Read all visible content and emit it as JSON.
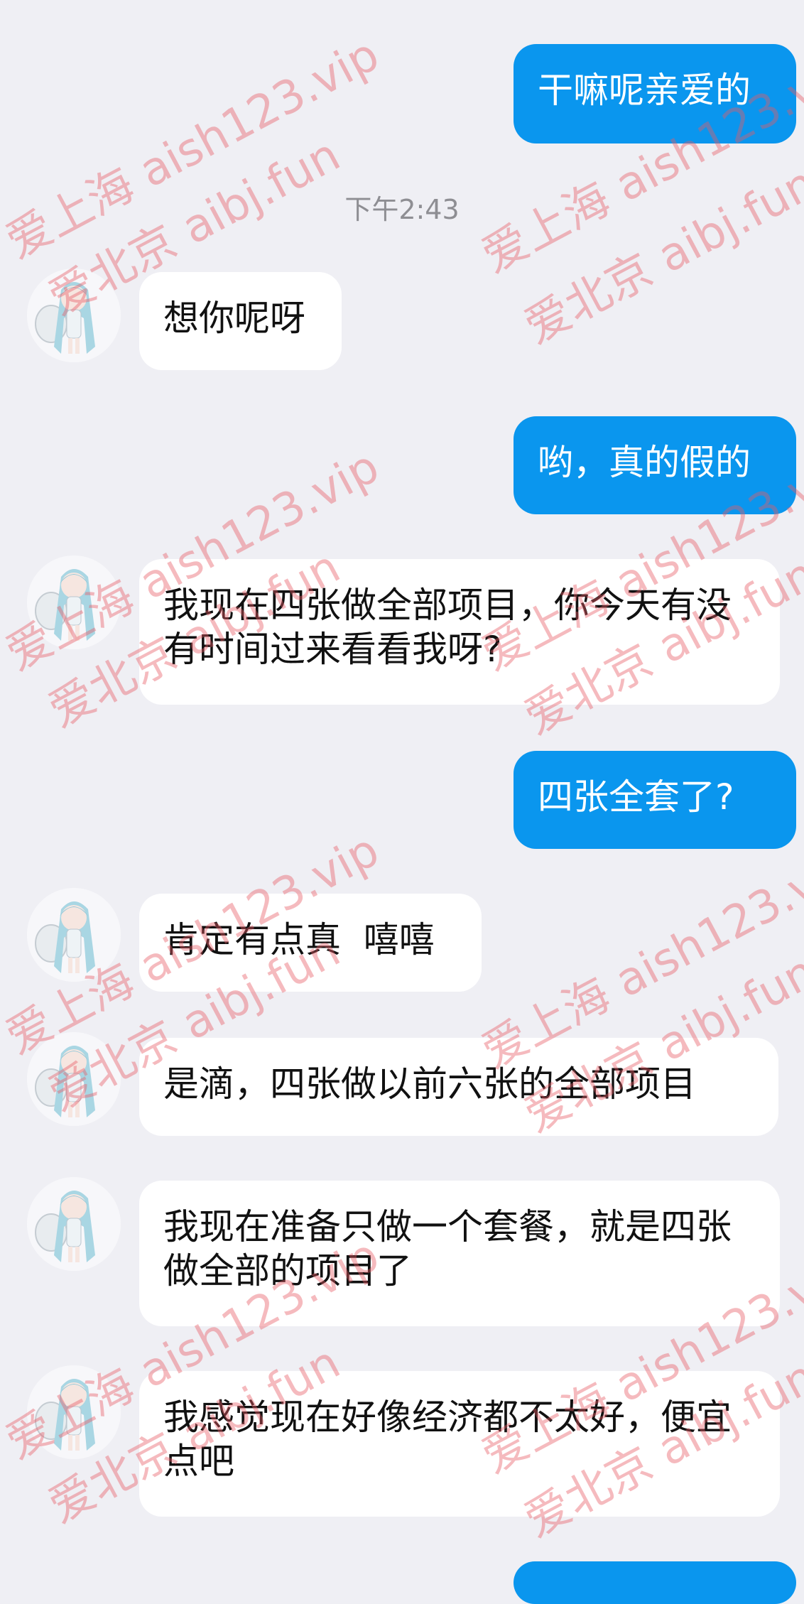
{
  "chat": {
    "messages": [
      {
        "id": "m1",
        "direction": "out",
        "text": "干嘛呢亲爱的"
      },
      {
        "id": "ts",
        "type": "timestamp",
        "text": "下午2:43"
      },
      {
        "id": "m2",
        "direction": "in",
        "text": "想你呢呀"
      },
      {
        "id": "m3",
        "direction": "out",
        "text": "哟，真的假的"
      },
      {
        "id": "m4",
        "direction": "in",
        "text": "我现在四张做全部项目，你今天有没有时间过来看看我呀?"
      },
      {
        "id": "m5",
        "direction": "out",
        "text": "四张全套了?"
      },
      {
        "id": "m6",
        "direction": "in",
        "text": "肯定有点真  嘻嘻"
      },
      {
        "id": "m7",
        "direction": "in",
        "text": "是滴，四张做以前六张的全部项目"
      },
      {
        "id": "m8",
        "direction": "in",
        "text": "我现在准备只做一个套餐，就是四张做全部的项目了"
      },
      {
        "id": "m9",
        "direction": "in",
        "text": "我感觉现在好像经济都不太好，便宜点吧"
      }
    ]
  },
  "watermark": {
    "line_a": "爱上海 aish123.vip",
    "line_b": "爱北京 aibj.fun"
  },
  "colors": {
    "background": "#efeff4",
    "outgoing_bubble": "#0a96ee",
    "incoming_bubble": "#ffffff"
  }
}
